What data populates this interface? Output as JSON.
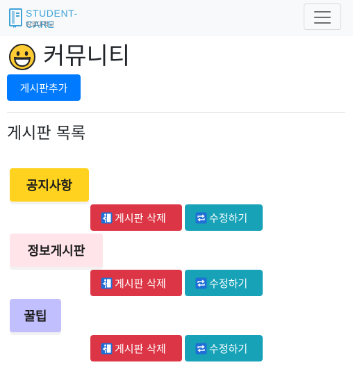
{
  "brand": {
    "name": "STUDENT-CARE",
    "subtitle": "임광대학교",
    "colors": {
      "logo": "#3fa3d8"
    }
  },
  "navbar": {
    "toggle_icon": "hamburger-icon"
  },
  "page": {
    "emoji": "grinning-face-emoji",
    "title": "커뮤니티",
    "add_button": "게시판추가",
    "section_title": "게시판 목록"
  },
  "boards": [
    {
      "name": "공지사항",
      "color": "#ffd21f",
      "delete_label": "게시판 삭제",
      "edit_label": "수정하기"
    },
    {
      "name": "정보게시판",
      "color": "#ffe4ea",
      "delete_label": "게시판 삭제",
      "edit_label": "수정하기"
    },
    {
      "name": "꿀팁",
      "color": "#c2bfff",
      "delete_label": "게시판 삭제",
      "edit_label": "수정하기"
    }
  ],
  "icons": {
    "delete": "exit-door-icon",
    "edit": "repeat-arrows-icon"
  },
  "colors": {
    "primary": "#007bff",
    "danger": "#dc3545",
    "info": "#17a2b8"
  }
}
